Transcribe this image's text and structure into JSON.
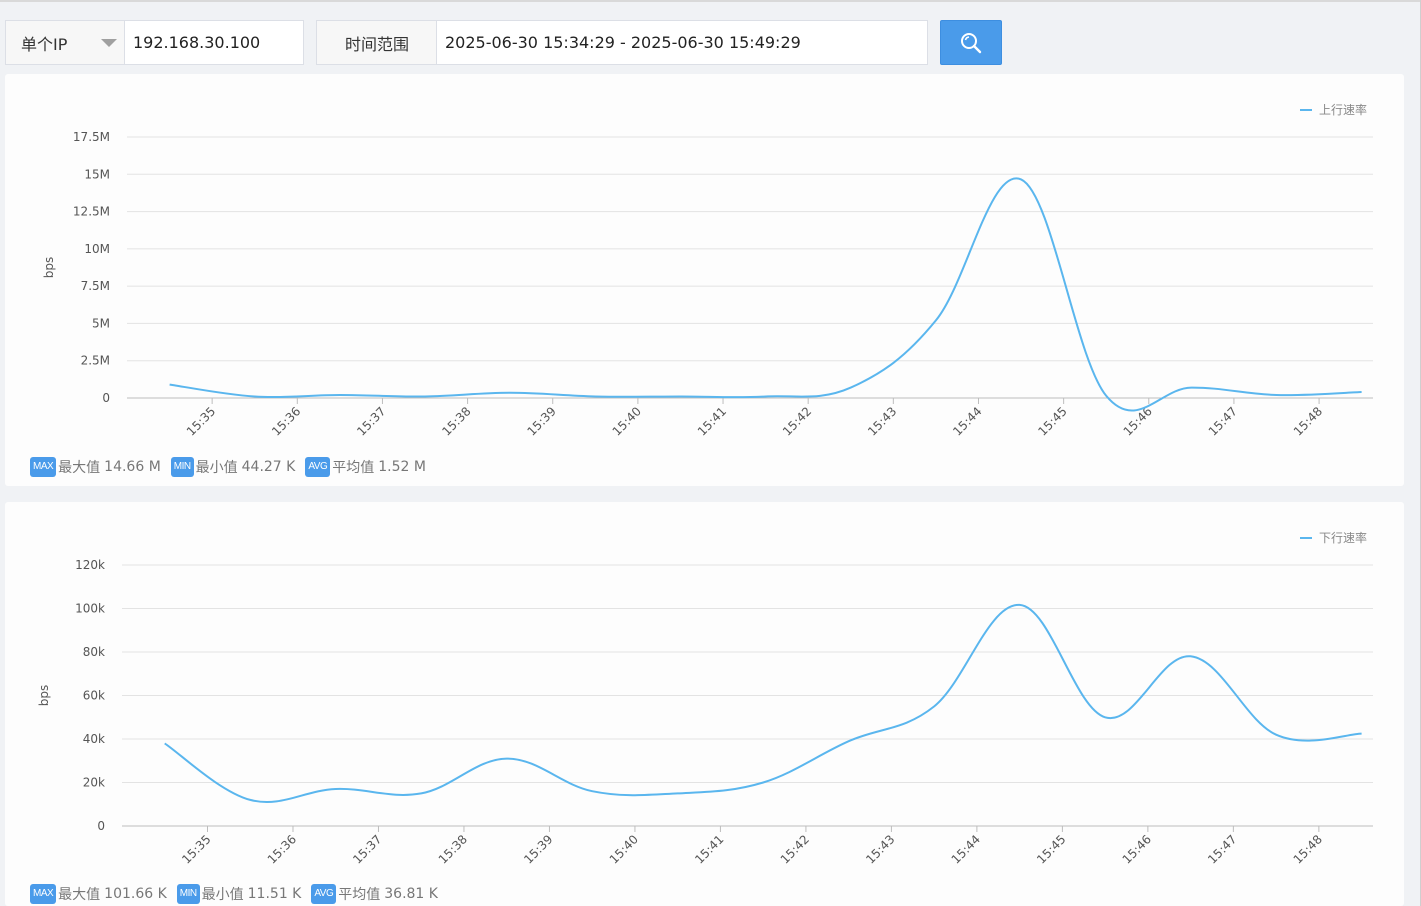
{
  "toolbar": {
    "ip_mode": "单个IP",
    "ip_value": "192.168.30.100",
    "range_label": "时间范围",
    "range_value": "2025-06-30 15:34:29 - 2025-06-30 15:49:29"
  },
  "colors": {
    "accent": "#4a9bea",
    "series": "#5ab6ee",
    "grid": "#e3e3e3"
  },
  "icons": {
    "search": "search-icon",
    "dropdown": "chevron-down-icon"
  },
  "chart_data": [
    {
      "type": "line",
      "title": "",
      "ylabel": "bps",
      "xlabel": "",
      "legend": {
        "label": "上行速率",
        "placement": "top-right"
      },
      "x_categories": [
        "15:35",
        "15:36",
        "15:37",
        "15:38",
        "15:39",
        "15:40",
        "15:41",
        "15:42",
        "15:43",
        "15:44",
        "15:45",
        "15:46",
        "15:47",
        "15:48"
      ],
      "y_ticks": [
        "0",
        "2.5M",
        "5M",
        "7.5M",
        "10M",
        "12.5M",
        "15M",
        "17.5M"
      ],
      "ylim": [
        0,
        17500000
      ],
      "grid": true,
      "series": [
        {
          "name": "上行速率",
          "x": [
            "15:34:30",
            "15:35:30",
            "15:36:30",
            "15:37:30",
            "15:38:30",
            "15:39:30",
            "15:40:30",
            "15:41:30",
            "15:42:30",
            "15:43:30",
            "15:44:30",
            "15:45:30",
            "15:46:30",
            "15:47:30",
            "15:48:30"
          ],
          "values": [
            900000,
            100000,
            200000,
            100000,
            350000,
            100000,
            100000,
            100000,
            700000,
            5200000,
            14660000,
            150000,
            700000,
            200000,
            400000
          ]
        }
      ],
      "stats": {
        "max": {
          "badge": "MAX",
          "label": "最大值",
          "value": "14.66 M"
        },
        "min": {
          "badge": "MIN",
          "label": "最小值",
          "value": "44.27 K"
        },
        "avg": {
          "badge": "AVG",
          "label": "平均值",
          "value": "1.52 M"
        }
      }
    },
    {
      "type": "line",
      "title": "",
      "ylabel": "bps",
      "xlabel": "",
      "legend": {
        "label": "下行速率",
        "placement": "top-right"
      },
      "x_categories": [
        "15:35",
        "15:36",
        "15:37",
        "15:38",
        "15:39",
        "15:40",
        "15:41",
        "15:42",
        "15:43",
        "15:44",
        "15:45",
        "15:46",
        "15:47",
        "15:48"
      ],
      "y_ticks": [
        "0",
        "20k",
        "40k",
        "60k",
        "80k",
        "100k",
        "120k"
      ],
      "ylim": [
        0,
        120000
      ],
      "grid": true,
      "series": [
        {
          "name": "下行速率",
          "x": [
            "15:34:30",
            "15:35:30",
            "15:36:30",
            "15:37:30",
            "15:38:30",
            "15:39:30",
            "15:40:30",
            "15:41:30",
            "15:42:30",
            "15:43:30",
            "15:44:30",
            "15:45:30",
            "15:46:30",
            "15:47:30",
            "15:48:30"
          ],
          "values": [
            38000,
            12000,
            17000,
            15000,
            31000,
            16000,
            15000,
            20000,
            39000,
            55000,
            101660,
            50000,
            78000,
            42000,
            42500
          ]
        }
      ],
      "stats": {
        "max": {
          "badge": "MAX",
          "label": "最大值",
          "value": "101.66 K"
        },
        "min": {
          "badge": "MIN",
          "label": "最小值",
          "value": "11.51 K"
        },
        "avg": {
          "badge": "AVG",
          "label": "平均值",
          "value": "36.81 K"
        }
      }
    }
  ]
}
